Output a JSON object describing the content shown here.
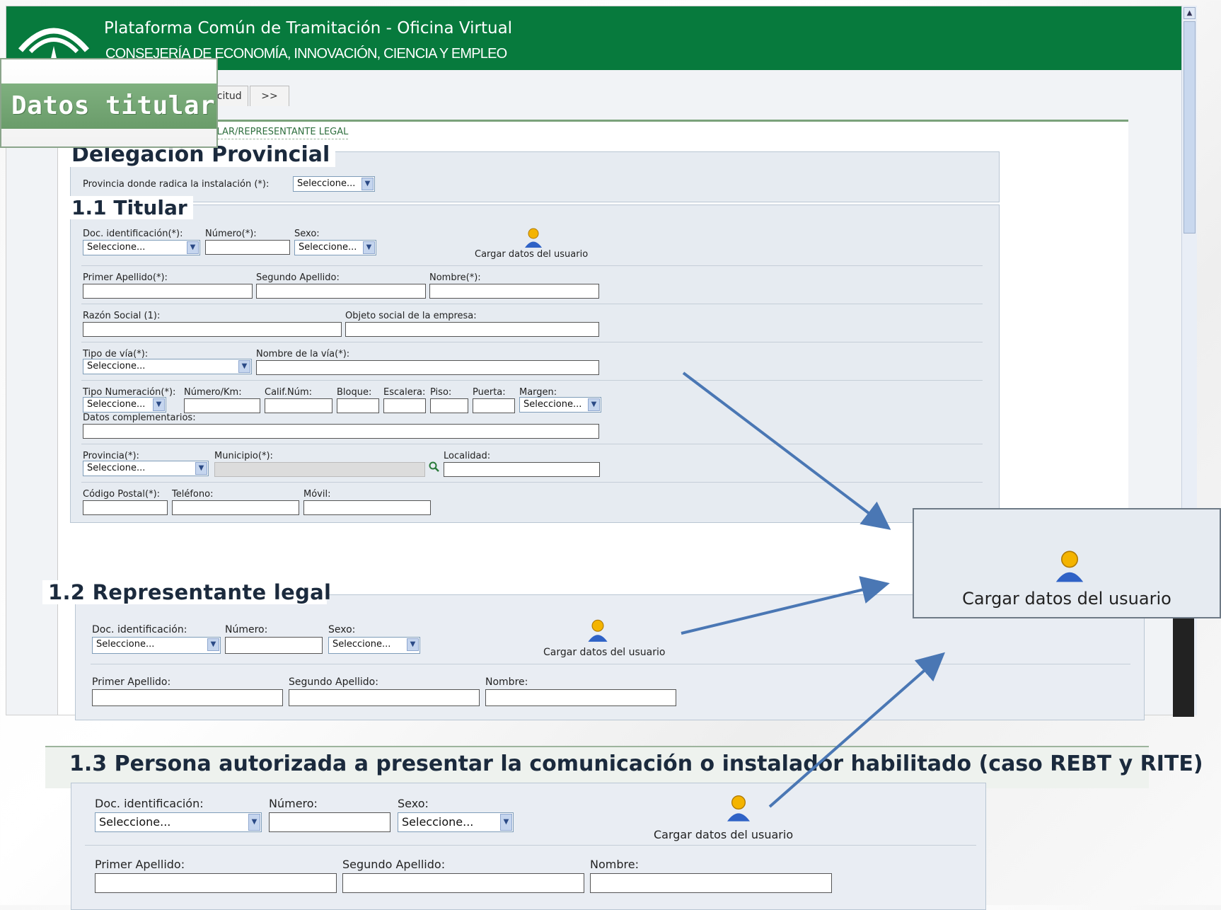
{
  "header": {
    "title": "Plataforma Común de Tramitación - Oficina Virtual",
    "subtitle": "CONSEJERÍA DE ECONOMÍA, INNOVACIÓN, CIENCIA Y EMPLEO"
  },
  "tabs": [
    "olicitud",
    ">>"
  ],
  "breadcrumb": "ULAR/REPRESENTANTE LEGAL",
  "overlay_title": "Datos titular",
  "delegacion": {
    "legend": "Delegación Provincial",
    "provincia_label": "Provincia donde radica la instalación (*):",
    "provincia_value": "Seleccione..."
  },
  "titular": {
    "legend": "1.1 Titular",
    "doc_label": "Doc. identificación(*):",
    "doc_value": "Seleccione...",
    "numero_label": "Número(*):",
    "sexo_label": "Sexo:",
    "sexo_value": "Seleccione...",
    "cargar": "Cargar datos del usuario",
    "apellido1_label": "Primer Apellido(*):",
    "apellido2_label": "Segundo Apellido:",
    "nombre_label": "Nombre(*):",
    "razon_label": "Razón Social (1):",
    "objeto_label": "Objeto social de la empresa:",
    "tipo_via_label": "Tipo de vía(*):",
    "tipo_via_value": "Seleccione...",
    "nombre_via_label": "Nombre de la vía(*):",
    "tipo_num_label": "Tipo Numeración(*):",
    "tipo_num_value": "Seleccione...",
    "numkm_label": "Número/Km:",
    "calif_label": "Calif.Núm:",
    "bloque_label": "Bloque:",
    "escalera_label": "Escalera:",
    "piso_label": "Piso:",
    "puerta_label": "Puerta:",
    "margen_label": "Margen:",
    "margen_value": "Seleccione...",
    "datos_comp_label": "Datos complementarios:",
    "provincia_label": "Provincia(*):",
    "provincia_value": "Seleccione...",
    "municipio_label": "Municipio(*):",
    "localidad_label": "Localidad:",
    "cp_label": "Código Postal(*):",
    "telefono_label": "Teléfono:",
    "movil_label": "Móvil:"
  },
  "representante": {
    "legend": "1.2 Representante legal",
    "doc_label": "Doc. identificación:",
    "doc_value": "Seleccione...",
    "numero_label": "Número:",
    "sexo_label": "Sexo:",
    "sexo_value": "Seleccione...",
    "cargar": "Cargar datos del usuario",
    "apellido1_label": "Primer Apellido:",
    "apellido2_label": "Segundo Apellido:",
    "nombre_label": "Nombre:"
  },
  "persona": {
    "legend": "1.3 Persona autorizada a presentar la comunicación o instalador habilitado (caso REBT y RITE)",
    "doc_label": "Doc. identificación:",
    "doc_value": "Seleccione...",
    "numero_label": "Número:",
    "sexo_label": "Sexo:",
    "sexo_value": "Seleccione...",
    "cargar": "Cargar datos del usuario",
    "apellido1_label": "Primer Apellido:",
    "apellido2_label": "Segundo Apellido:",
    "nombre_label": "Nombre:"
  },
  "zoom": {
    "cargar": "Cargar datos del usuario"
  },
  "colors": {
    "header_green": "#077a3d",
    "arrow_blue": "#4a77b4",
    "fieldset_bg": "#e6ebf1"
  }
}
